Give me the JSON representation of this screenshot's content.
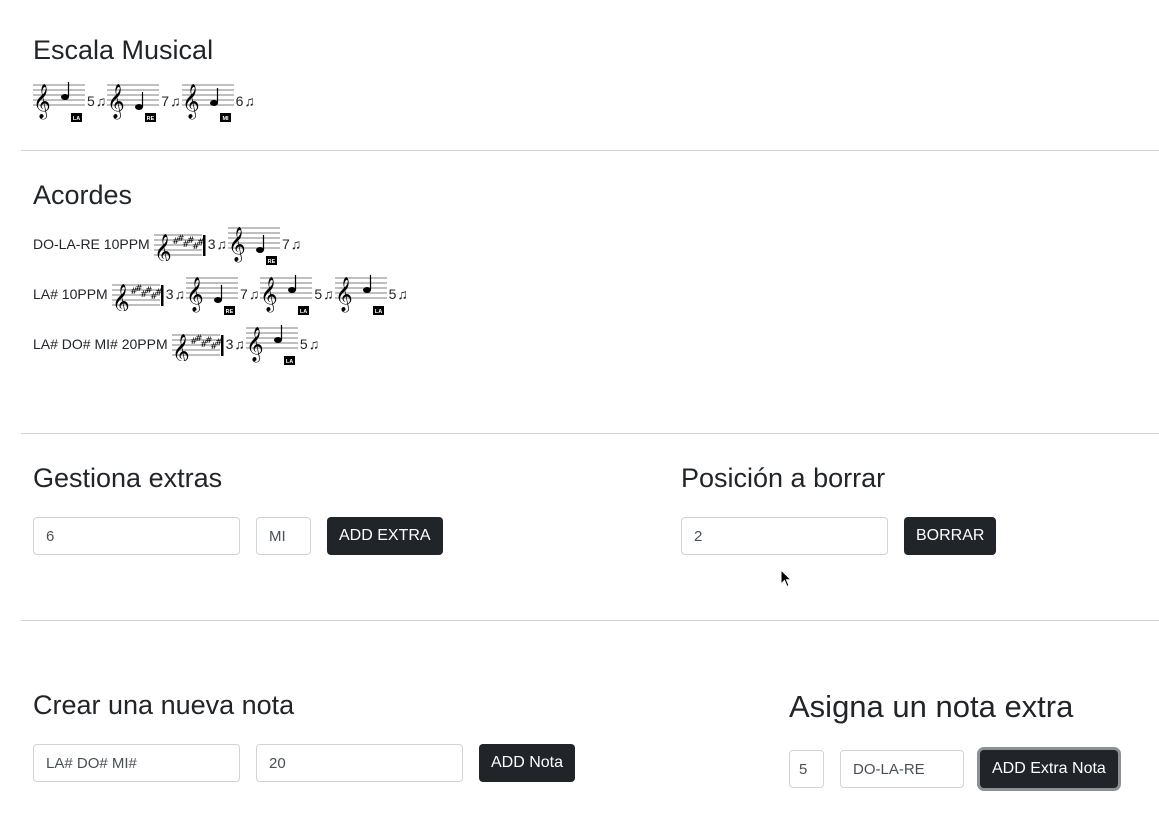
{
  "escala": {
    "title": "Escala Musical",
    "items": [
      {
        "note": "LA",
        "count": "5",
        "glyph": "♫"
      },
      {
        "note": "RE",
        "count": "7",
        "glyph": "♫"
      },
      {
        "note": "MI",
        "count": "6",
        "glyph": "♫"
      }
    ]
  },
  "acordes": {
    "title": "Acordes",
    "rows": [
      {
        "label": "DO-LA-RE 10PPM",
        "chord_count": "3",
        "extras": [
          {
            "note": "RE",
            "count": "7"
          }
        ]
      },
      {
        "label": "LA# 10PPM",
        "chord_count": "3",
        "extras": [
          {
            "note": "RE",
            "count": "7"
          },
          {
            "note": "LA",
            "count": "5"
          },
          {
            "note": "LA",
            "count": "5"
          }
        ]
      },
      {
        "label": "LA# DO# MI# 20PPM",
        "chord_count": "3",
        "extras": [
          {
            "note": "LA",
            "count": "5"
          }
        ]
      }
    ]
  },
  "gestiona": {
    "title": "Gestiona extras",
    "count_value": "6",
    "note_value": "MI",
    "button": "ADD EXTRA"
  },
  "borrar": {
    "title": "Posición a borrar",
    "value": "2",
    "button": "BORRAR"
  },
  "crear": {
    "title": "Crear una nueva nota",
    "notes_value": "LA# DO# MI#",
    "ppm_value": "20",
    "button": "ADD Nota"
  },
  "asigna": {
    "title": "Asigna un nota extra",
    "position_value": "5",
    "chord_value": "DO-LA-RE",
    "button": "ADD Extra Nota"
  }
}
